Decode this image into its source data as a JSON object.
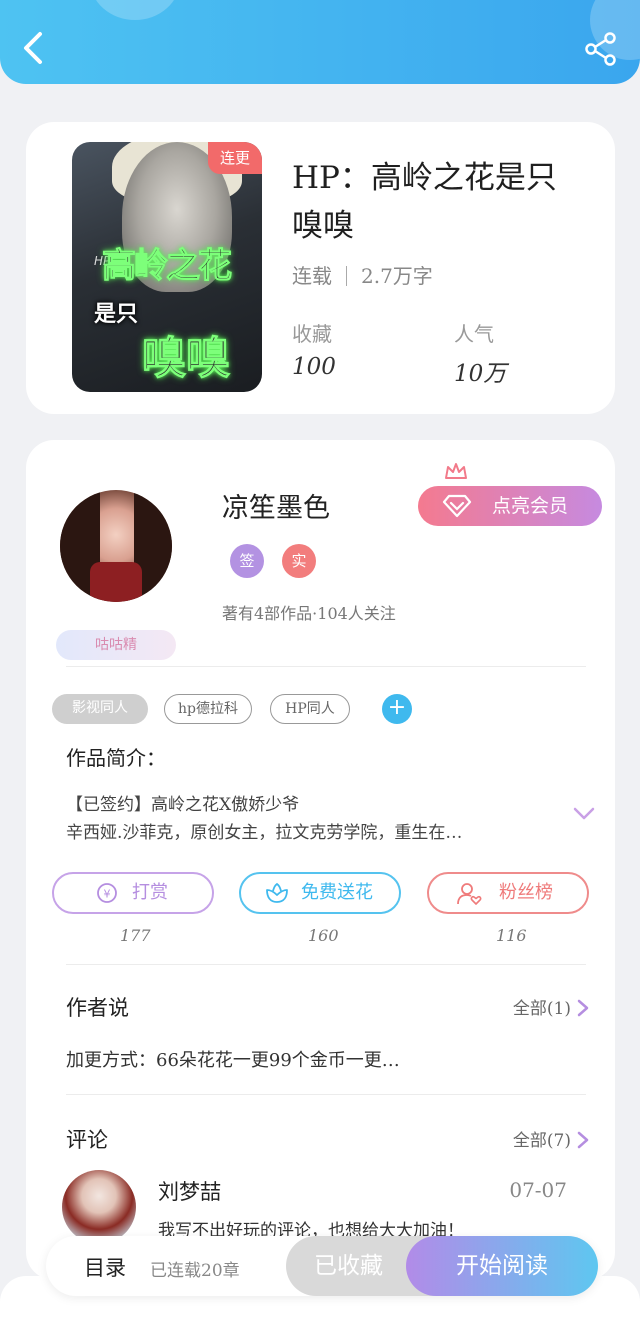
{
  "book": {
    "status_badge": "连更",
    "cover_text_hp": "HP",
    "cover_text_1": "高岭之花",
    "cover_text_2": "是只",
    "cover_text_3": "嗅嗅",
    "title_line1": "HP：高岭之花是只",
    "title_line2": "嗅嗅",
    "status": "连载",
    "word_count": "2.7万字",
    "favorites_label": "收藏",
    "favorites_value": "100",
    "popularity_label": "人气",
    "popularity_value": "10万"
  },
  "author": {
    "name": "凉笙墨色",
    "badge_sign": "签",
    "badge_real": "实",
    "stats": "著有4部作品·104人关注",
    "title_badge": "咕咕精",
    "vip_button": "点亮会员"
  },
  "genre_tags": [
    "影视同人",
    "hp德拉科",
    "HP同人"
  ],
  "intro": {
    "label": "作品简介：",
    "line1": "【已签约】高岭之花X傲娇少爷",
    "line2": "辛西娅.沙菲克，原创女主，拉文克劳学院，重生在…"
  },
  "actions": [
    {
      "label": "打赏",
      "count": "177"
    },
    {
      "label": "免费送花",
      "count": "160"
    },
    {
      "label": "粉丝榜",
      "count": "116"
    }
  ],
  "author_says": {
    "title": "作者说",
    "all_label": "全部(1)",
    "text": "加更方式：66朵花花一更99个金币一更…"
  },
  "comments": {
    "title": "评论",
    "all_label": "全部(7)",
    "items": [
      {
        "name": "刘梦喆",
        "date": "07-07",
        "text": "我写不出好玩的评论，也想给大大加油！"
      }
    ]
  },
  "bottom": {
    "catalog": "目录",
    "catalog_sub": "已连载20章",
    "collected": "已收藏",
    "read": "开始阅读"
  },
  "colors": {
    "header": "#3fb4f0",
    "vip_gradient_start": "#f47a8f",
    "vip_gradient_end": "#c68ae0",
    "reward": "#b58ee0",
    "flower": "#3fb9ee",
    "fans": "#ef7b7b"
  }
}
